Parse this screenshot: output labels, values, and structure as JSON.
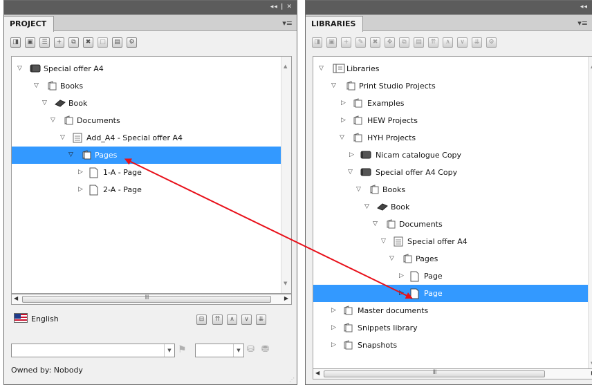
{
  "project_panel": {
    "tab_label": "PROJECT",
    "strip_controls": "◂◂ | ✕",
    "panel_menu_icon": "▾≡",
    "tree_rows": [
      {
        "label": "Special offer A4",
        "icon": "book-icon",
        "expanded": true
      },
      {
        "label": "Books",
        "icon": "folder-icon",
        "expanded": true
      },
      {
        "label": "Book",
        "icon": "book-icon",
        "expanded": true
      },
      {
        "label": "Documents",
        "icon": "folder-icon",
        "expanded": true
      },
      {
        "label": "Add_A4 - Special offer A4",
        "icon": "document-icon",
        "expanded": true
      },
      {
        "label": "Pages",
        "icon": "folder-icon",
        "expanded": true,
        "selected": true
      },
      {
        "label": "1-A - Page",
        "icon": "page-icon",
        "expanded": false
      },
      {
        "label": "2-A - Page",
        "icon": "page-icon",
        "expanded": false
      }
    ],
    "hscroll_grip": "III",
    "language": "English",
    "owned_by": "Owned by: Nobody"
  },
  "libraries_panel": {
    "tab_label": "LIBRARIES",
    "strip_controls": "◂◂",
    "panel_menu_icon": "▾≡",
    "tree_rows": [
      {
        "label": "Libraries",
        "icon": "library-icon",
        "expanded": true
      },
      {
        "label": "Print Studio Projects",
        "icon": "folder-icon",
        "expanded": true
      },
      {
        "label": "Examples",
        "icon": "folder-icon",
        "expanded": false
      },
      {
        "label": "HEW Projects",
        "icon": "folder-icon",
        "expanded": false
      },
      {
        "label": "HYH Projects",
        "icon": "folder-icon",
        "expanded": true
      },
      {
        "label": "Nicam catalogue Copy",
        "icon": "book-icon",
        "expanded": false
      },
      {
        "label": "Special offer A4 Copy",
        "icon": "book-icon",
        "expanded": true
      },
      {
        "label": "Books",
        "icon": "folder-icon",
        "expanded": true
      },
      {
        "label": "Book",
        "icon": "book-icon",
        "expanded": true
      },
      {
        "label": "Documents",
        "icon": "folder-icon",
        "expanded": true
      },
      {
        "label": "Special offer A4",
        "icon": "document-icon",
        "expanded": true
      },
      {
        "label": "Pages",
        "icon": "folder-icon",
        "expanded": true
      },
      {
        "label": "Page",
        "icon": "page-icon",
        "expanded": false
      },
      {
        "label": "Page",
        "icon": "page-icon",
        "expanded": false,
        "selected": true
      },
      {
        "label": "Master documents",
        "icon": "folder-icon",
        "expanded": false
      },
      {
        "label": "Snippets library",
        "icon": "folder-icon",
        "expanded": false
      },
      {
        "label": "Snapshots",
        "icon": "folder-icon",
        "expanded": false
      }
    ],
    "hscroll_grip": "III"
  },
  "colors": {
    "selection": "#3399ff",
    "arrow": "#e8101a",
    "panel_bg": "#f0f0f0",
    "strip_bg": "#5c5c5c"
  }
}
